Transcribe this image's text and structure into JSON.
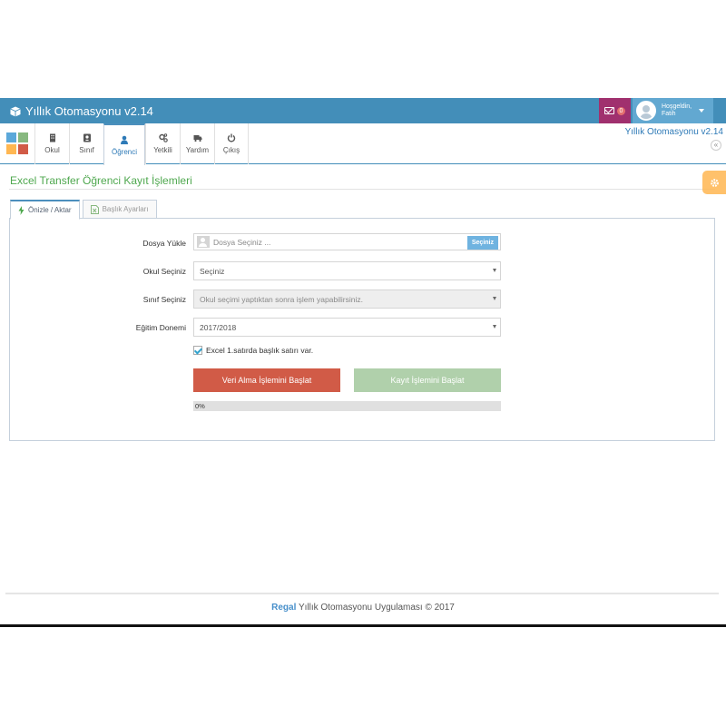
{
  "header": {
    "app_title": "Yıllık Otomasyonu v2.14",
    "message_count": "0",
    "user_greeting": "Hoşgeldin,",
    "user_name": "Fatih"
  },
  "nav": {
    "items": [
      {
        "label": "Okul",
        "icon": "building-icon"
      },
      {
        "label": "Sınıf",
        "icon": "contacts-book-icon"
      },
      {
        "label": "Öğrenci",
        "icon": "user-icon"
      },
      {
        "label": "Yetkili",
        "icon": "gears-icon"
      },
      {
        "label": "Yardım",
        "icon": "truck-icon"
      },
      {
        "label": "Çıkış",
        "icon": "power-icon"
      }
    ],
    "active_index": 2,
    "right_title": "Yıllık Otomasyonu v2.14",
    "collapse_glyph": "«"
  },
  "page": {
    "title": "Excel Transfer Öğrenci Kayıt İşlemleri"
  },
  "tabs": [
    {
      "label": "Önizle / Aktar",
      "icon": "bolt-icon"
    },
    {
      "label": "Başlık Ayarları",
      "icon": "excel-file-icon"
    }
  ],
  "form": {
    "file_label": "Dosya Yükle",
    "file_placeholder": "Dosya Seçiniz ...",
    "file_button": "Seçiniz",
    "school_label": "Okul Seçiniz",
    "school_value": "Seçiniz",
    "class_label": "Sınıf Seçiniz",
    "class_value": "Okul seçimi yaptıktan sonra işlem yapabilirsiniz.",
    "term_label": "Eğitim Donemi",
    "term_value": "2017/2018",
    "header_row_checkbox": "Excel 1.satırda başlık satırı var.",
    "header_row_checked": true,
    "start_fetch_button": "Veri Alma İşlemini Başlat",
    "start_record_button": "Kayıt İşlemini Başlat",
    "progress_text": "0%",
    "progress_value": 0
  },
  "footer": {
    "brand": "Regal",
    "text": " Yıllık Otomasyonu Uygulaması © 2017"
  },
  "colors": {
    "topbar": "#438eb9",
    "accent_green": "#4fa84f",
    "danger": "#d15b47",
    "success": "#87b87f",
    "messages": "#a0306e"
  }
}
